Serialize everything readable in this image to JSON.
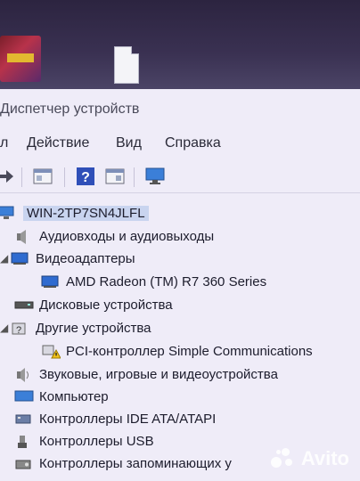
{
  "window": {
    "title": "Диспетчер устройств"
  },
  "menu": [
    {
      "label": "Действие"
    },
    {
      "label": "Вид"
    },
    {
      "label": "Справка"
    }
  ],
  "menu_first_partial": "л",
  "tree": {
    "root": "WIN-2TP7SN4JLFL",
    "items": [
      {
        "label": "Аудиовходы и аудиовыходы",
        "icon": "speaker-icon"
      },
      {
        "label": "Видеоадаптеры",
        "icon": "display-adapter-icon"
      },
      {
        "label": "AMD Radeon (TM) R7 360 Series",
        "icon": "monitor-icon"
      },
      {
        "label": "Дисковые устройства",
        "icon": "disk-drive-icon"
      },
      {
        "label": "Другие устройства",
        "icon": "unknown-device-icon"
      },
      {
        "label": "PCI-контроллер Simple Communications",
        "icon": "warning-device-icon"
      },
      {
        "label": "Звуковые, игровые и видеоустройства",
        "icon": "sound-icon"
      },
      {
        "label": "Компьютер",
        "icon": "computer-icon"
      },
      {
        "label": "Контроллеры IDE ATA/ATAPI",
        "icon": "ide-controller-icon"
      },
      {
        "label": "Контроллеры USB",
        "icon": "usb-icon"
      },
      {
        "label": "Контроллеры запоминающих у",
        "icon": "storage-controller-icon"
      }
    ]
  },
  "watermark": "Avito",
  "colors": {
    "selection": "#c9d4ef",
    "window_bg": "#efecf8",
    "accent_blue": "#2f6bd0"
  }
}
